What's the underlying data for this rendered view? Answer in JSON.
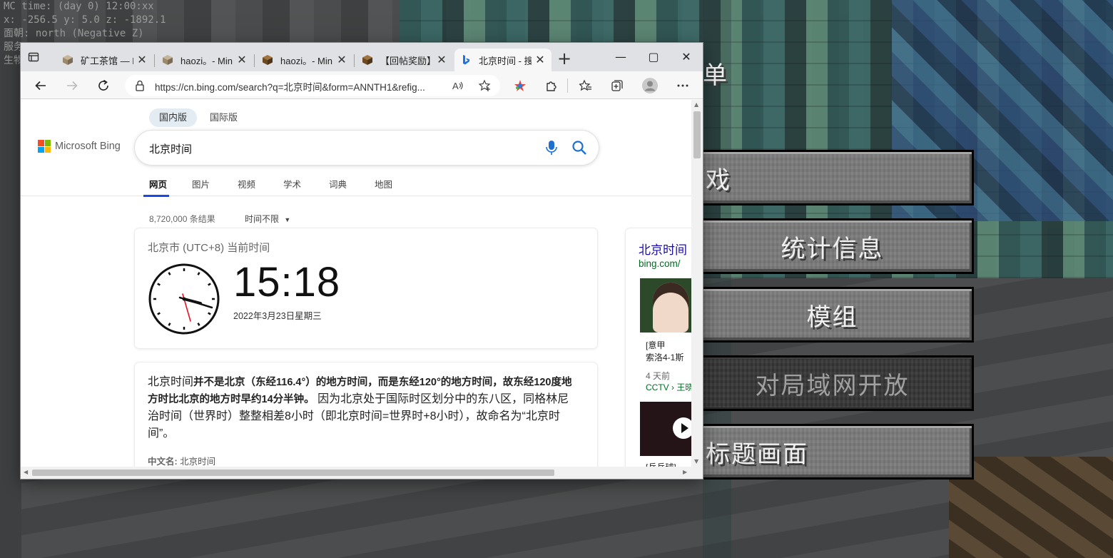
{
  "game": {
    "debug_lines": [
      "MC time: (day 0) 12:00:xx",
      "x: -256.5 y: 5.0 z: -1892.1",
      "面朝: north (Negative Z)",
      "服务",
      "生物"
    ],
    "menu_title_fragment": "单",
    "buttons": [
      {
        "label": "戏",
        "enabled": true
      },
      {
        "label": "统计信息",
        "enabled": true
      },
      {
        "label": "模组",
        "enabled": true
      },
      {
        "label": "对局域网开放",
        "enabled": false
      },
      {
        "label": "标题画面",
        "enabled": true
      }
    ]
  },
  "browser": {
    "tabs": [
      {
        "title": "矿工茶馆 — M",
        "icon": "minecraft-block-icon"
      },
      {
        "title": "haozi。- Min",
        "icon": "minecraft-block-icon"
      },
      {
        "title": "haozi。- Min",
        "icon": "minecraft-crafting-icon"
      },
      {
        "title": "【回帖奖励】",
        "icon": "minecraft-crafting-icon"
      },
      {
        "title": "北京时间 - 搜",
        "icon": "bing-icon",
        "active": true
      }
    ],
    "new_tab_symbol": "+",
    "window_controls": {
      "minimize": "—",
      "maximize": "▢",
      "close": "✕"
    },
    "address": "https://cn.bing.com/search?q=北京时间&form=ANNTH1&refig..."
  },
  "bing": {
    "region_tabs": [
      "国内版",
      "国际版"
    ],
    "logo_text": "Microsoft Bing",
    "query": "北京时间",
    "nav_tabs": [
      "网页",
      "图片",
      "视频",
      "学术",
      "词典",
      "地图"
    ],
    "result_count": "8,720,000 条结果",
    "time_filter": "时间不限",
    "time_card": {
      "location": "北京市 (UTC+8) 当前时间",
      "time": "15:18",
      "date": "2022年3月23日星期三"
    },
    "desc_card": {
      "lead": "北京时间",
      "bold": "并不是北京（东经116.4°）的地方时间，而是东经120°的地方时间，故东经120度地方时比北京的地方时早约14分半钟。",
      "rest": " 因为北京处于国际时区划分中的东八区，同格林尼治时间（世界时）整整相差8小时（即北京时间=世界时+8小时），故命名为“北京时间”。",
      "meta_label": "中文名:",
      "meta_value": "北京时间"
    },
    "side_card": {
      "title": "北京时间",
      "url": "bing.com/",
      "item1_line1": "[意甲",
      "item1_line2": "索洛4-1斯",
      "item1_age": "4 天前",
      "item1_source": "CCTV › 王晓",
      "item2_line1": "[乒乓球]"
    }
  },
  "colors": {
    "bing_blue": "#174ae4",
    "link_blue": "#1a0dab",
    "url_green": "#006d21",
    "mc_button": "#7a7a7a",
    "mc_button_disabled": "#353535"
  }
}
